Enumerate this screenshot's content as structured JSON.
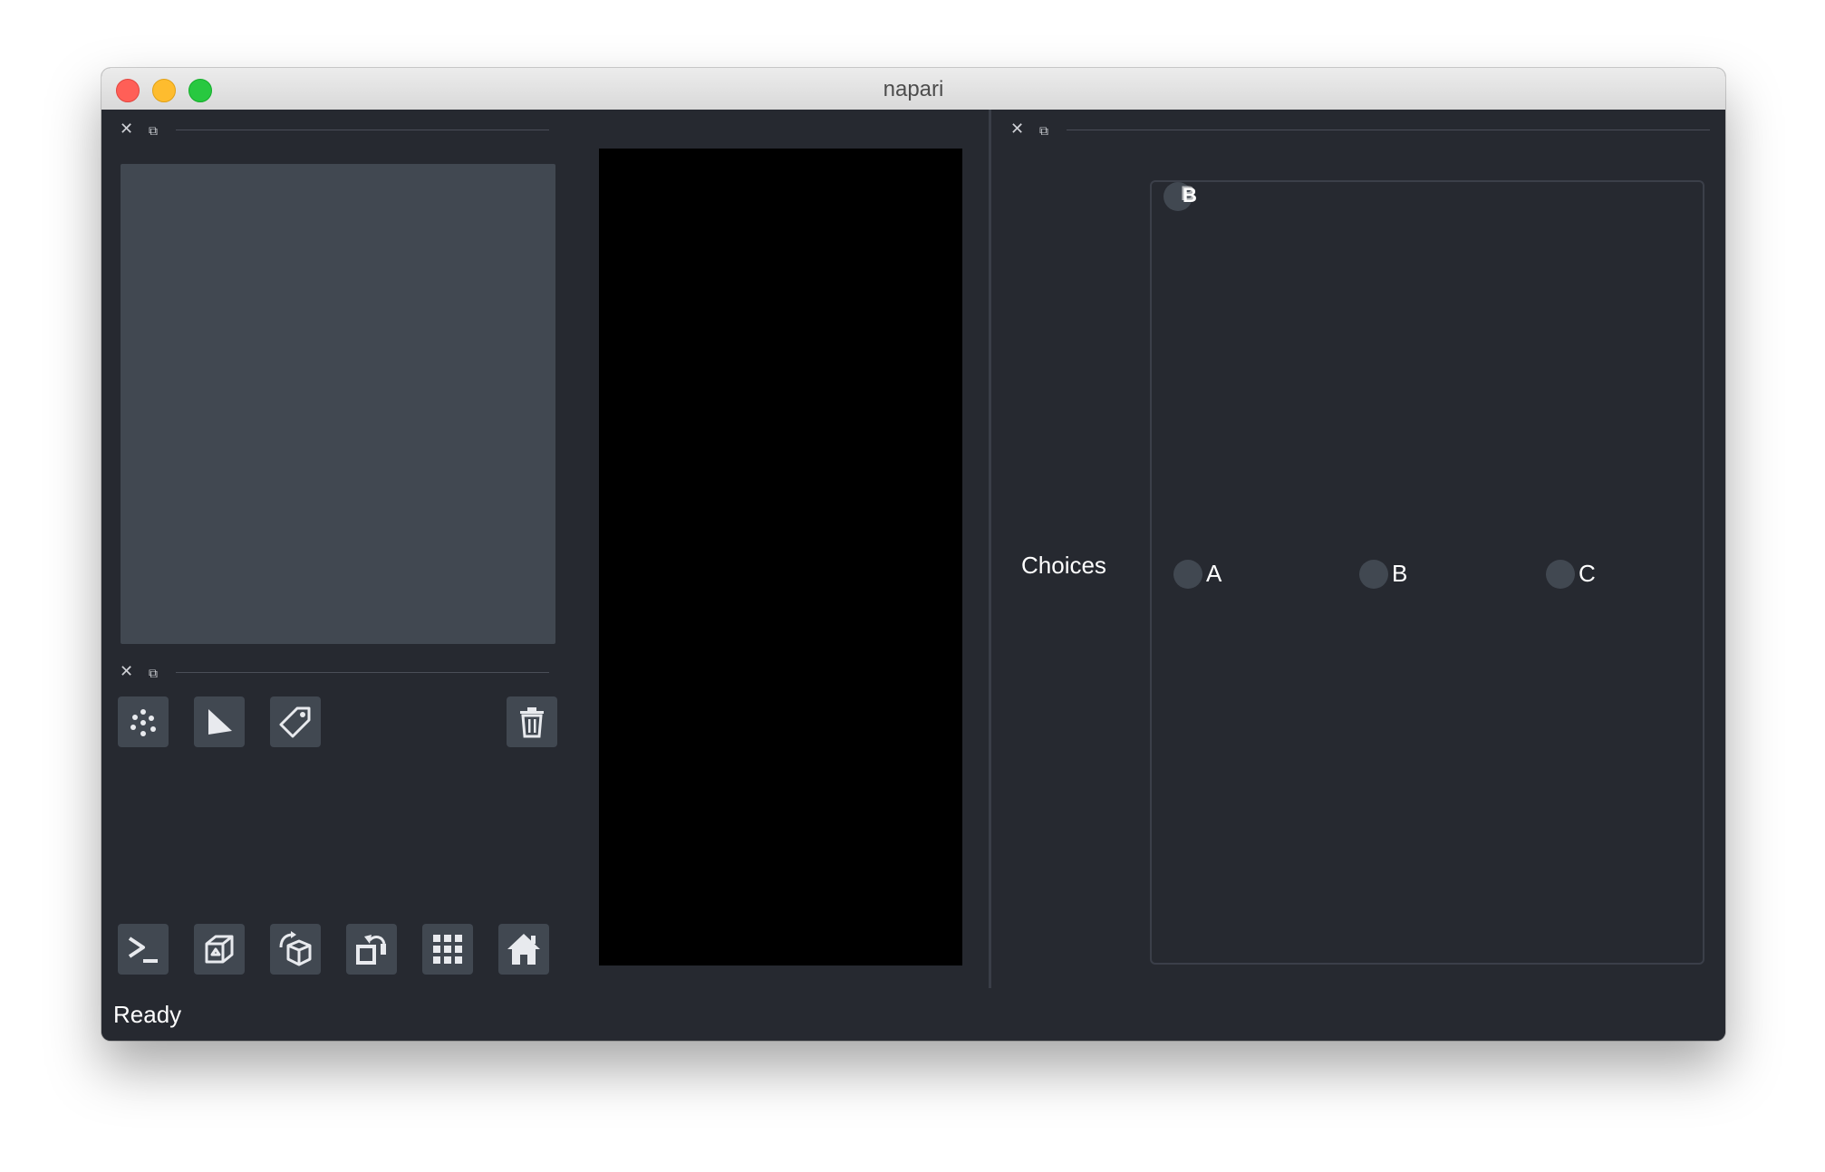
{
  "window": {
    "title": "napari"
  },
  "left_dock_top": {
    "close_glyph": "✕",
    "float_glyph": "⧉"
  },
  "left_dock_bottom": {
    "close_glyph": "✕",
    "float_glyph": "⧉"
  },
  "right_dock": {
    "close_glyph": "✕",
    "float_glyph": "⧉"
  },
  "layer_buttons": [
    {
      "icon": "new-points-icon"
    },
    {
      "icon": "new-shapes-icon"
    },
    {
      "icon": "new-labels-icon"
    },
    {
      "icon": "delete-layer-icon"
    }
  ],
  "viewer_buttons": [
    {
      "icon": "console-icon"
    },
    {
      "icon": "ndisplay-toggle-icon"
    },
    {
      "icon": "roll-dims-icon"
    },
    {
      "icon": "transpose-dims-icon"
    },
    {
      "icon": "grid-view-icon"
    },
    {
      "icon": "reset-view-icon"
    }
  ],
  "widget": {
    "label": "Choices",
    "overlap_text": "B",
    "options": [
      "A",
      "B",
      "C"
    ]
  },
  "status": "Ready",
  "colors": {
    "background": "#262930",
    "button": "#414851",
    "foreground": "#ffffff",
    "canvas": "#000000"
  }
}
